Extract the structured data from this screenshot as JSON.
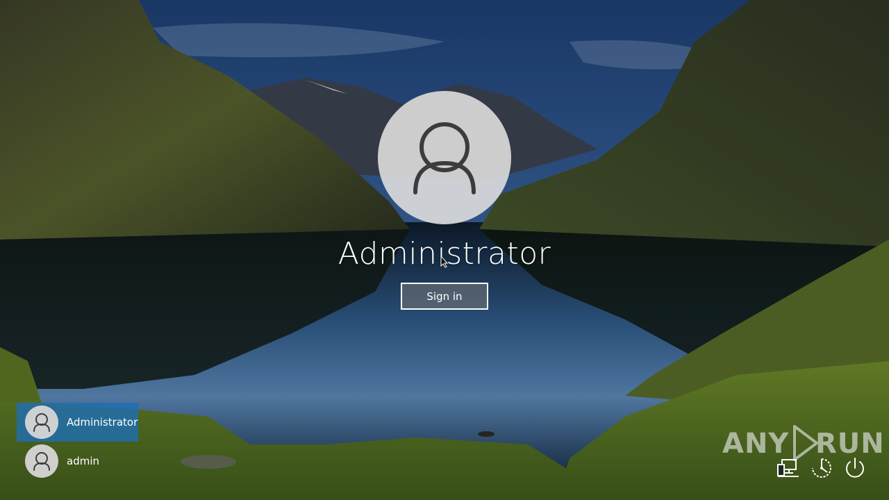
{
  "lock_screen": {
    "selected_user": "Administrator",
    "sign_in_label": "Sign in"
  },
  "user_list": [
    {
      "name": "Administrator",
      "selected": true
    },
    {
      "name": "admin",
      "selected": false
    }
  ],
  "watermark": {
    "left_text": "ANY",
    "right_text": "RUN"
  },
  "system_icons": [
    "network-icon",
    "ease-of-access-icon",
    "power-icon"
  ],
  "colors": {
    "selected_user_bg": "#1e6eb4",
    "avatar_bg": "#dadada",
    "avatar_glyph": "#3c3c3c"
  }
}
